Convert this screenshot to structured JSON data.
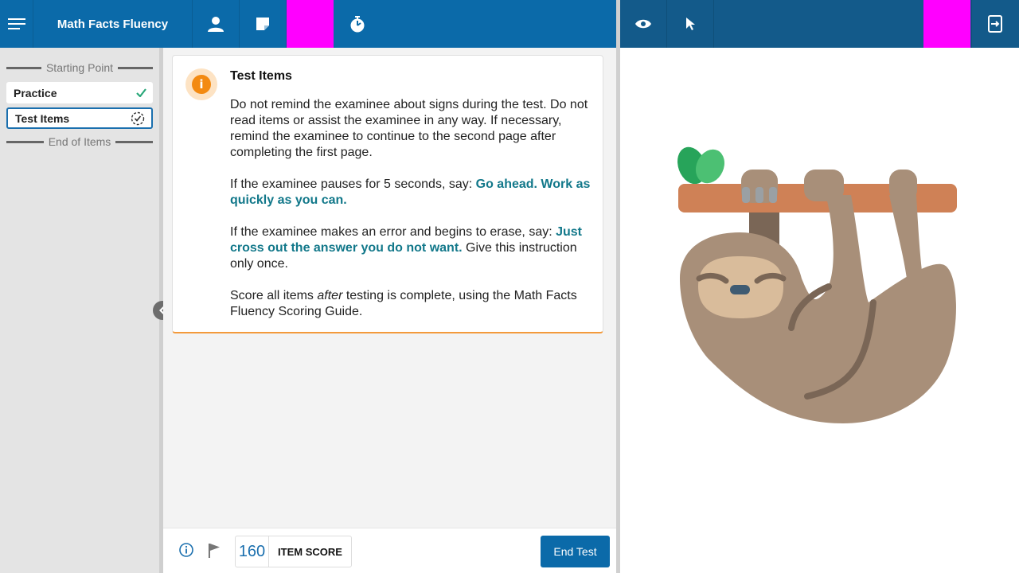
{
  "header": {
    "title": "Math Facts Fluency",
    "icons": [
      "menu-icon",
      "person-icon",
      "note-icon",
      "timer-icon",
      "eye-icon",
      "cursor-icon",
      "exit-device-icon"
    ],
    "highlight_color": "#ff00ff",
    "brand_color": "#0b6aa9"
  },
  "sidebar": {
    "start_label": "Starting Point",
    "end_label": "End of Items",
    "items": [
      {
        "label": "Practice",
        "status": "complete"
      },
      {
        "label": "Test Items",
        "status": "in-progress"
      }
    ]
  },
  "card": {
    "title": "Test Items",
    "p1": "Do not remind the examinee about signs during the test. Do not read items or assist the examinee in any way. If necessary, remind the examinee to continue to the second page after completing the first page.",
    "p2_pre": "If the examinee pauses for 5 seconds, say: ",
    "p2_say": "Go ahead. Work as quickly as you can.",
    "p3_pre": "If the examinee makes an error and begins to erase, say: ",
    "p3_say": "Just cross out the answer you do not want.",
    "p3_post": " Give this instruction only once.",
    "p4_pre": "Score all items ",
    "p4_em": "after",
    "p4_post": " testing is complete, using the Math Facts Fluency Scoring Guide."
  },
  "footer": {
    "score_value": "160",
    "score_label": "ITEM SCORE",
    "end_label": "End Test"
  },
  "stimulus": {
    "image": "sloth-illustration"
  }
}
